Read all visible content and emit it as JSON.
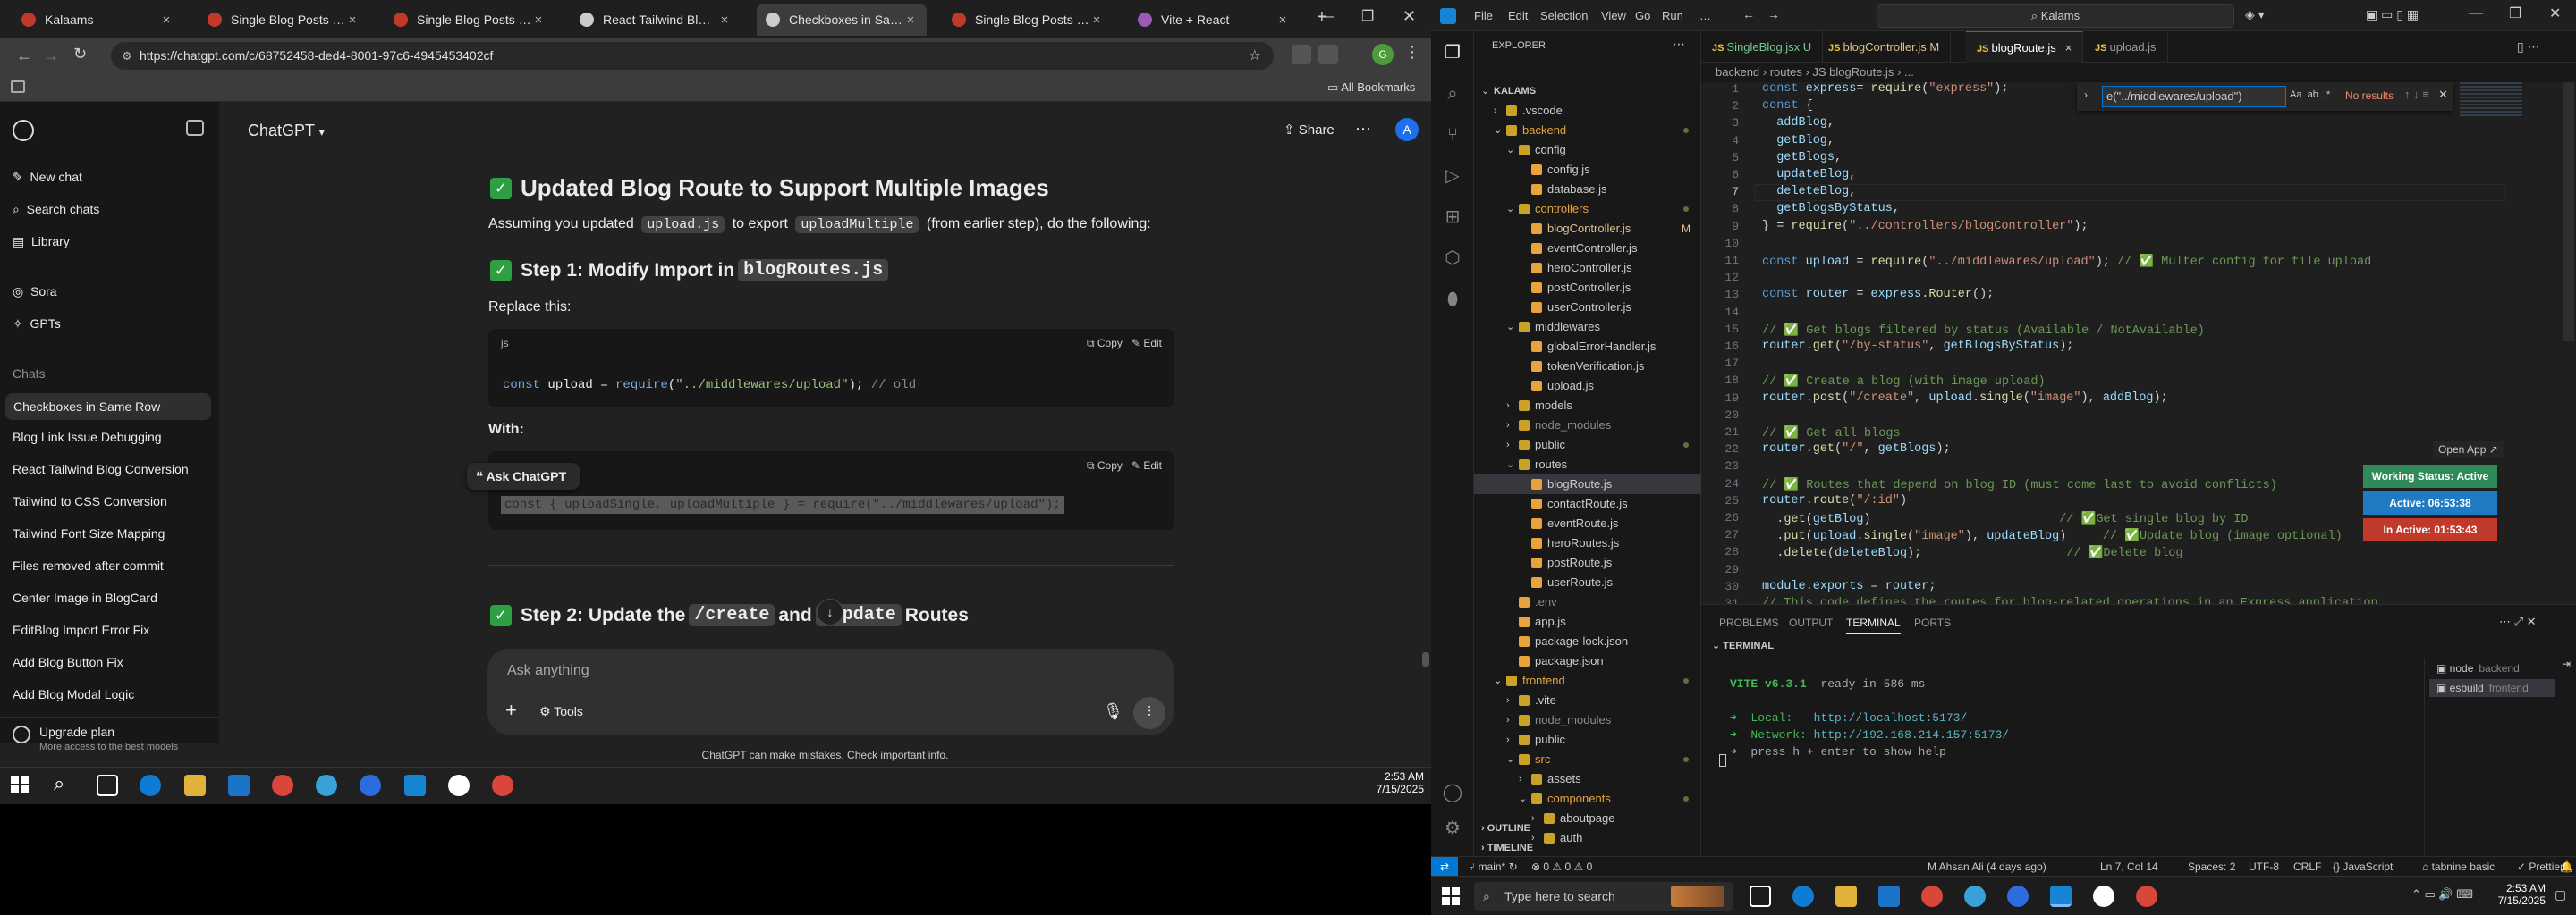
{
  "chrome": {
    "tabs": [
      {
        "title": "Kalaams",
        "color": "#c0392b"
      },
      {
        "title": "Single Blog Posts Page",
        "color": "#c0392b"
      },
      {
        "title": "Single Blog Posts Page",
        "color": "#c0392b"
      },
      {
        "title": "React Tailwind Blog Co",
        "color": "#cccccc"
      },
      {
        "title": "Checkboxes in Same Row",
        "color": "#cccccc"
      },
      {
        "title": "Single Blog Posts Page",
        "color": "#c0392b"
      },
      {
        "title": "Vite + React",
        "color": "#9b59b6"
      }
    ],
    "url": "https://chatgpt.com/c/68752458-ded4-8001-97c6-4945453402cf",
    "bookmarks_label": "All Bookmarks"
  },
  "chatgpt": {
    "sidebar": {
      "new_chat": "New chat",
      "search": "Search chats",
      "library": "Library",
      "sora": "Sora",
      "gpts": "GPTs",
      "chats_heading": "Chats",
      "chats": [
        "Checkboxes in Same Row",
        "Blog Link Issue Debugging",
        "React Tailwind Blog Conversion",
        "Tailwind to CSS Conversion",
        "Tailwind Font Size Mapping",
        "Files removed after commit",
        "Center Image in BlogCard",
        "EditBlog Import Error Fix",
        "Add Blog Button Fix",
        "Add Blog Modal Logic"
      ],
      "upgrade_title": "Upgrade plan",
      "upgrade_sub": "More access to the best models"
    },
    "header": {
      "model": "ChatGPT",
      "share": "Share",
      "avatar": "A"
    },
    "content": {
      "h_main": "Updated Blog Route to Support Multiple Images",
      "p_intro_1": "Assuming you updated",
      "p_intro_code1": "upload.js",
      "p_intro_2": "to export",
      "p_intro_code2": "uploadMultiple",
      "p_intro_3": "(from earlier step), do the following:",
      "h_step1_pre": "Step 1: Modify Import in",
      "h_step1_code": "blogRoutes.js",
      "p_replace": "Replace this:",
      "code1_lang": "js",
      "code1_copy": "Copy",
      "code1_edit": "Edit",
      "code1_line": {
        "kw": "const",
        "a": " upload = ",
        "fn": "require",
        "b": "(",
        "s": "\"../middlewares/upload\"",
        "c": "); ",
        "cm": "// old"
      },
      "p_with": "With:",
      "ask_chatgpt": "Ask ChatGPT",
      "code2_copy": "Copy",
      "code2_edit": "Edit",
      "code2_line": "const { uploadSingle, uploadMultiple } = require(\"../middlewares/upload\");",
      "h_step2_pre": "Step 2: Update the",
      "h_step2_code1": "/create",
      "h_step2_mid": "and",
      "h_step2_code2": "/update",
      "h_step2_post": "Routes",
      "composer_placeholder": "Ask anything",
      "tools": "Tools",
      "disclaimer": "ChatGPT can make mistakes. Check important info."
    }
  },
  "taskbar_left": {
    "time": "2:53 AM",
    "date": "7/15/2025"
  },
  "vscode": {
    "menu": [
      "File",
      "Edit",
      "Selection",
      "View",
      "Go",
      "Run",
      "…"
    ],
    "search": "Kalams",
    "explorer_title": "EXPLORER",
    "tree": [
      {
        "name": "KALAMS",
        "depth": 0,
        "type": "root"
      },
      {
        "name": ".vscode",
        "depth": 1,
        "type": "folder",
        "open": false
      },
      {
        "name": "backend",
        "depth": 1,
        "type": "folder",
        "open": true,
        "color": "#e8a33d",
        "dot": true
      },
      {
        "name": "config",
        "depth": 2,
        "type": "folder",
        "open": true
      },
      {
        "name": "config.js",
        "depth": 3,
        "type": "file"
      },
      {
        "name": "database.js",
        "depth": 3,
        "type": "file"
      },
      {
        "name": "controllers",
        "depth": 2,
        "type": "folder",
        "open": true,
        "color": "#e8a33d",
        "dot": true
      },
      {
        "name": "blogController.js",
        "depth": 3,
        "type": "file",
        "color": "#e2c08d",
        "badge": "M"
      },
      {
        "name": "eventController.js",
        "depth": 3,
        "type": "file"
      },
      {
        "name": "heroController.js",
        "depth": 3,
        "type": "file"
      },
      {
        "name": "postController.js",
        "depth": 3,
        "type": "file"
      },
      {
        "name": "userController.js",
        "depth": 3,
        "type": "file"
      },
      {
        "name": "middlewares",
        "depth": 2,
        "type": "folder",
        "open": true
      },
      {
        "name": "globalErrorHandler.js",
        "depth": 3,
        "type": "file"
      },
      {
        "name": "tokenVerification.js",
        "depth": 3,
        "type": "file"
      },
      {
        "name": "upload.js",
        "depth": 3,
        "type": "file"
      },
      {
        "name": "models",
        "depth": 2,
        "type": "folder",
        "open": false
      },
      {
        "name": "node_modules",
        "depth": 2,
        "type": "folder",
        "open": false,
        "color": "#8c8c8c"
      },
      {
        "name": "public",
        "depth": 2,
        "type": "folder",
        "open": false,
        "dot": true
      },
      {
        "name": "routes",
        "depth": 2,
        "type": "folder",
        "open": true
      },
      {
        "name": "blogRoute.js",
        "depth": 3,
        "type": "file",
        "selected": true
      },
      {
        "name": "contactRoute.js",
        "depth": 3,
        "type": "file"
      },
      {
        "name": "eventRoute.js",
        "depth": 3,
        "type": "file"
      },
      {
        "name": "heroRoutes.js",
        "depth": 3,
        "type": "file"
      },
      {
        "name": "postRoute.js",
        "depth": 3,
        "type": "file"
      },
      {
        "name": "userRoute.js",
        "depth": 3,
        "type": "file"
      },
      {
        "name": ".env",
        "depth": 2,
        "type": "file",
        "color": "#8c8c8c"
      },
      {
        "name": "app.js",
        "depth": 2,
        "type": "file"
      },
      {
        "name": "package-lock.json",
        "depth": 2,
        "type": "file"
      },
      {
        "name": "package.json",
        "depth": 2,
        "type": "file"
      },
      {
        "name": "frontend",
        "depth": 1,
        "type": "folder",
        "open": true,
        "color": "#e8a33d",
        "dot": true
      },
      {
        "name": ".vite",
        "depth": 2,
        "type": "folder",
        "open": false
      },
      {
        "name": "node_modules",
        "depth": 2,
        "type": "folder",
        "open": false,
        "color": "#8c8c8c"
      },
      {
        "name": "public",
        "depth": 2,
        "type": "folder",
        "open": false
      },
      {
        "name": "src",
        "depth": 2,
        "type": "folder",
        "open": true,
        "color": "#e8a33d",
        "dot": true
      },
      {
        "name": "assets",
        "depth": 3,
        "type": "folder",
        "open": false
      },
      {
        "name": "components",
        "depth": 3,
        "type": "folder",
        "open": true,
        "color": "#e8a33d",
        "dot": true
      },
      {
        "name": "aboutpage",
        "depth": 4,
        "type": "folder",
        "open": false
      },
      {
        "name": "auth",
        "depth": 4,
        "type": "folder",
        "open": false
      }
    ],
    "outline": "OUTLINE",
    "timeline": "TIMELINE",
    "tabs": [
      {
        "label": "SingleBlog.jsx U"
      },
      {
        "label": "blogController.js M"
      },
      {
        "label": "blogRoute.js",
        "active": true
      },
      {
        "label": "upload.js"
      }
    ],
    "breadcrumb": "backend › routes › JS blogRoute.js › ...",
    "find": {
      "value": "e(\"../middlewares/upload\")",
      "aa": "Aa",
      "ab": "ab",
      "re": ".*",
      "result": "No results"
    },
    "code": [
      [
        [
          "k",
          "const "
        ],
        [
          "v",
          "express"
        ],
        [
          "",
          "= "
        ],
        [
          "f",
          "require"
        ],
        [
          "",
          "("
        ],
        [
          "s",
          "\"express\""
        ],
        [
          "",
          ");"
        ]
      ],
      [
        [
          "k",
          "const "
        ],
        [
          "",
          "{"
        ]
      ],
      [
        [
          "",
          "  "
        ],
        [
          "v",
          "addBlog"
        ],
        [
          "",
          ","
        ]
      ],
      [
        [
          "",
          "  "
        ],
        [
          "v",
          "getBlog"
        ],
        [
          "",
          ","
        ]
      ],
      [
        [
          "",
          "  "
        ],
        [
          "v",
          "getBlogs"
        ],
        [
          "",
          ","
        ]
      ],
      [
        [
          "",
          "  "
        ],
        [
          "v",
          "updateBlog"
        ],
        [
          "",
          ","
        ]
      ],
      [
        [
          "",
          "  "
        ],
        [
          "v",
          "deleteBlog"
        ],
        [
          "",
          ","
        ]
      ],
      [
        [
          "",
          "  "
        ],
        [
          "v",
          "getBlogsByStatus"
        ],
        [
          "",
          ","
        ]
      ],
      [
        [
          "",
          "} = "
        ],
        [
          "f",
          "require"
        ],
        [
          "",
          "("
        ],
        [
          "s",
          "\"../controllers/blogController\""
        ],
        [
          "",
          ");"
        ]
      ],
      [],
      [
        [
          "k",
          "const "
        ],
        [
          "v",
          "upload"
        ],
        [
          "",
          " = "
        ],
        [
          "f",
          "require"
        ],
        [
          "",
          "("
        ],
        [
          "s",
          "\"../middlewares/upload\""
        ],
        [
          "",
          "); "
        ],
        [
          "c",
          "// ✅ Multer config for file upload"
        ]
      ],
      [],
      [
        [
          "k",
          "const "
        ],
        [
          "v",
          "router"
        ],
        [
          "",
          " = "
        ],
        [
          "v",
          "express"
        ],
        [
          "",
          "."
        ],
        [
          "f",
          "Router"
        ],
        [
          "",
          "();"
        ]
      ],
      [],
      [
        [
          "c",
          "// ✅ Get blogs filtered by status (Available / NotAvailable)"
        ]
      ],
      [
        [
          "v",
          "router"
        ],
        [
          "",
          "."
        ],
        [
          "f",
          "get"
        ],
        [
          "",
          "("
        ],
        [
          "s",
          "\"/by-status\""
        ],
        [
          "",
          ", "
        ],
        [
          "v",
          "getBlogsByStatus"
        ],
        [
          "",
          ");"
        ]
      ],
      [],
      [
        [
          "c",
          "// ✅ Create a blog (with image upload)"
        ]
      ],
      [
        [
          "v",
          "router"
        ],
        [
          "",
          "."
        ],
        [
          "f",
          "post"
        ],
        [
          "",
          "("
        ],
        [
          "s",
          "\"/create\""
        ],
        [
          "",
          ", "
        ],
        [
          "v",
          "upload"
        ],
        [
          "",
          "."
        ],
        [
          "f",
          "single"
        ],
        [
          "",
          "("
        ],
        [
          "s",
          "\"image\""
        ],
        [
          "",
          "), "
        ],
        [
          "v",
          "addBlog"
        ],
        [
          "",
          ");"
        ]
      ],
      [],
      [
        [
          "c",
          "// ✅ Get all blogs"
        ]
      ],
      [
        [
          "v",
          "router"
        ],
        [
          "",
          "."
        ],
        [
          "f",
          "get"
        ],
        [
          "",
          "("
        ],
        [
          "s",
          "\"/\""
        ],
        [
          "",
          ", "
        ],
        [
          "v",
          "getBlogs"
        ],
        [
          "",
          ");"
        ]
      ],
      [],
      [
        [
          "c",
          "// ✅ Routes that depend on blog ID (must come last to avoid conflicts)"
        ]
      ],
      [
        [
          "v",
          "router"
        ],
        [
          "",
          "."
        ],
        [
          "f",
          "route"
        ],
        [
          "",
          "("
        ],
        [
          "s",
          "\"/:id\""
        ],
        [
          "",
          ")"
        ]
      ],
      [
        [
          "",
          "  ."
        ],
        [
          "f",
          "get"
        ],
        [
          "",
          "("
        ],
        [
          "v",
          "getBlog"
        ],
        [
          "",
          ")                          "
        ],
        [
          "c",
          "// ✅Get single blog by ID"
        ]
      ],
      [
        [
          "",
          "  ."
        ],
        [
          "f",
          "put"
        ],
        [
          "",
          "("
        ],
        [
          "v",
          "upload"
        ],
        [
          "",
          "."
        ],
        [
          "f",
          "single"
        ],
        [
          "",
          "("
        ],
        [
          "s",
          "\"image\""
        ],
        [
          "",
          "), "
        ],
        [
          "v",
          "updateBlog"
        ],
        [
          "",
          ")     "
        ],
        [
          "c",
          "// ✅Update blog (image optional)"
        ]
      ],
      [
        [
          "",
          "  ."
        ],
        [
          "f",
          "delete"
        ],
        [
          "",
          "("
        ],
        [
          "v",
          "deleteBlog"
        ],
        [
          "",
          ");                    "
        ],
        [
          "c",
          "// ✅Delete blog"
        ]
      ],
      [],
      [
        [
          "v",
          "module"
        ],
        [
          "",
          "."
        ],
        [
          "v",
          "exports"
        ],
        [
          "",
          " = "
        ],
        [
          "v",
          "router"
        ],
        [
          "",
          ";"
        ]
      ],
      [
        [
          "c",
          "// This code defines the routes for blog-related operations in an Express application."
        ]
      ]
    ],
    "open_app": "Open App ↗",
    "badges": [
      {
        "label": "Working Status: Active",
        "color": "#2e8b57"
      },
      {
        "label": "Active: 06:53:38",
        "color": "#1e7bc4"
      },
      {
        "label": "In Active: 01:53:43",
        "color": "#c0392b"
      }
    ],
    "panel_tabs": [
      "PROBLEMS",
      "OUTPUT",
      "TERMINAL",
      "PORTS"
    ],
    "terminal_title": "TERMINAL",
    "terminal": {
      "vite": "VITE v6.3.1",
      "ready": "ready in 586 ms",
      "local_label": "➜  Local:",
      "local_url": "http://localhost:5173/",
      "network_label": "➜  Network:",
      "network_url": "http://192.168.214.157:5173/",
      "help": "➜  press h + enter to show help"
    },
    "term_sessions": [
      {
        "name": "node",
        "sub": "backend"
      },
      {
        "name": "esbuild",
        "sub": "frontend"
      }
    ],
    "status": {
      "branch": "main*",
      "errors": "⊗ 0 ⚠ 0 ⚠ 0",
      "blame": "M Ahsan Ali (4 days ago)",
      "cursor": "Ln 7, Col 14",
      "spaces": "Spaces: 2",
      "enc": "UTF-8",
      "eol": "CRLF",
      "lang": "{} JavaScript",
      "tabnine": "tabnine basic",
      "prettier": "✓ Prettier"
    }
  },
  "taskbar_right": {
    "search": "Type here to search",
    "time": "2:53 AM",
    "date": "7/15/2025"
  }
}
